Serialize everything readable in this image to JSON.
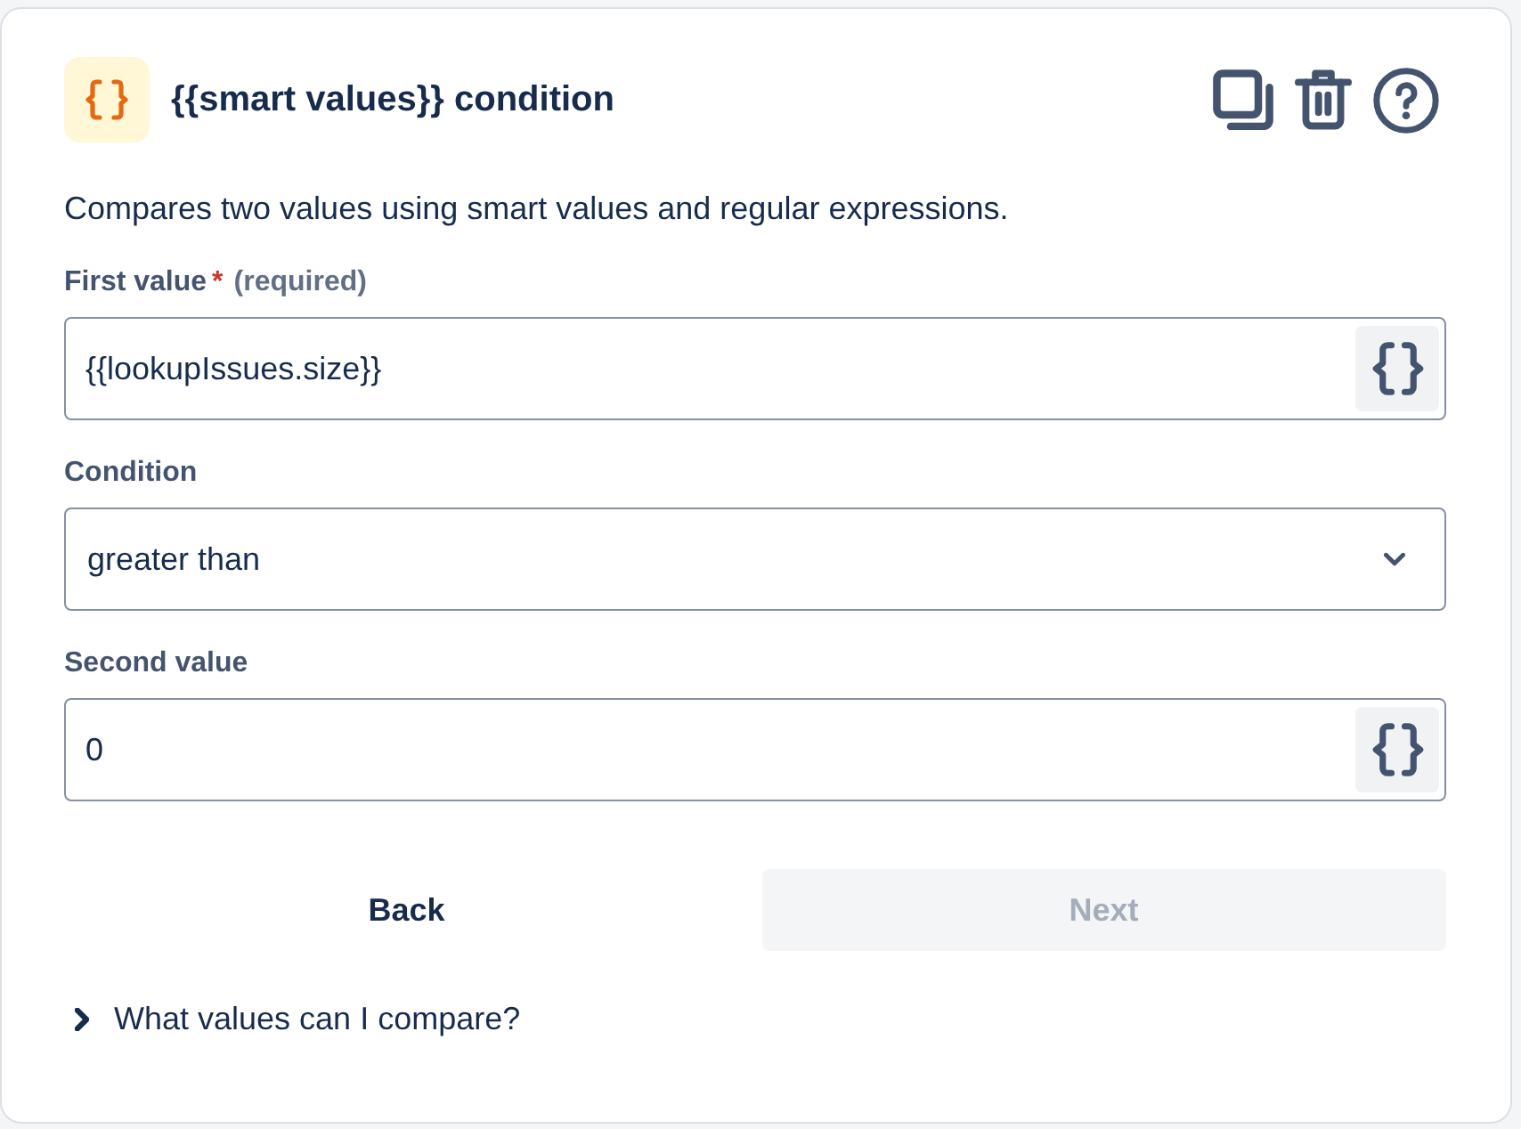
{
  "header": {
    "title": "{{smart values}} condition"
  },
  "description": "Compares two values using smart values and regular expressions.",
  "fields": [
    {
      "kind": "text",
      "label": "First value",
      "required_mark": "*",
      "required_note": "(required)",
      "value": "{{lookupIssues.size}}"
    },
    {
      "kind": "select",
      "label": "Condition",
      "value": "greater than"
    },
    {
      "kind": "text",
      "label": "Second value",
      "value": "0"
    }
  ],
  "buttons": [
    {
      "kind": "subtle",
      "label": "Back",
      "disabled": false
    },
    {
      "kind": "primary",
      "label": "Next",
      "disabled": true
    }
  ],
  "disclosure": {
    "label": "What values can I compare?",
    "expanded": false
  }
}
